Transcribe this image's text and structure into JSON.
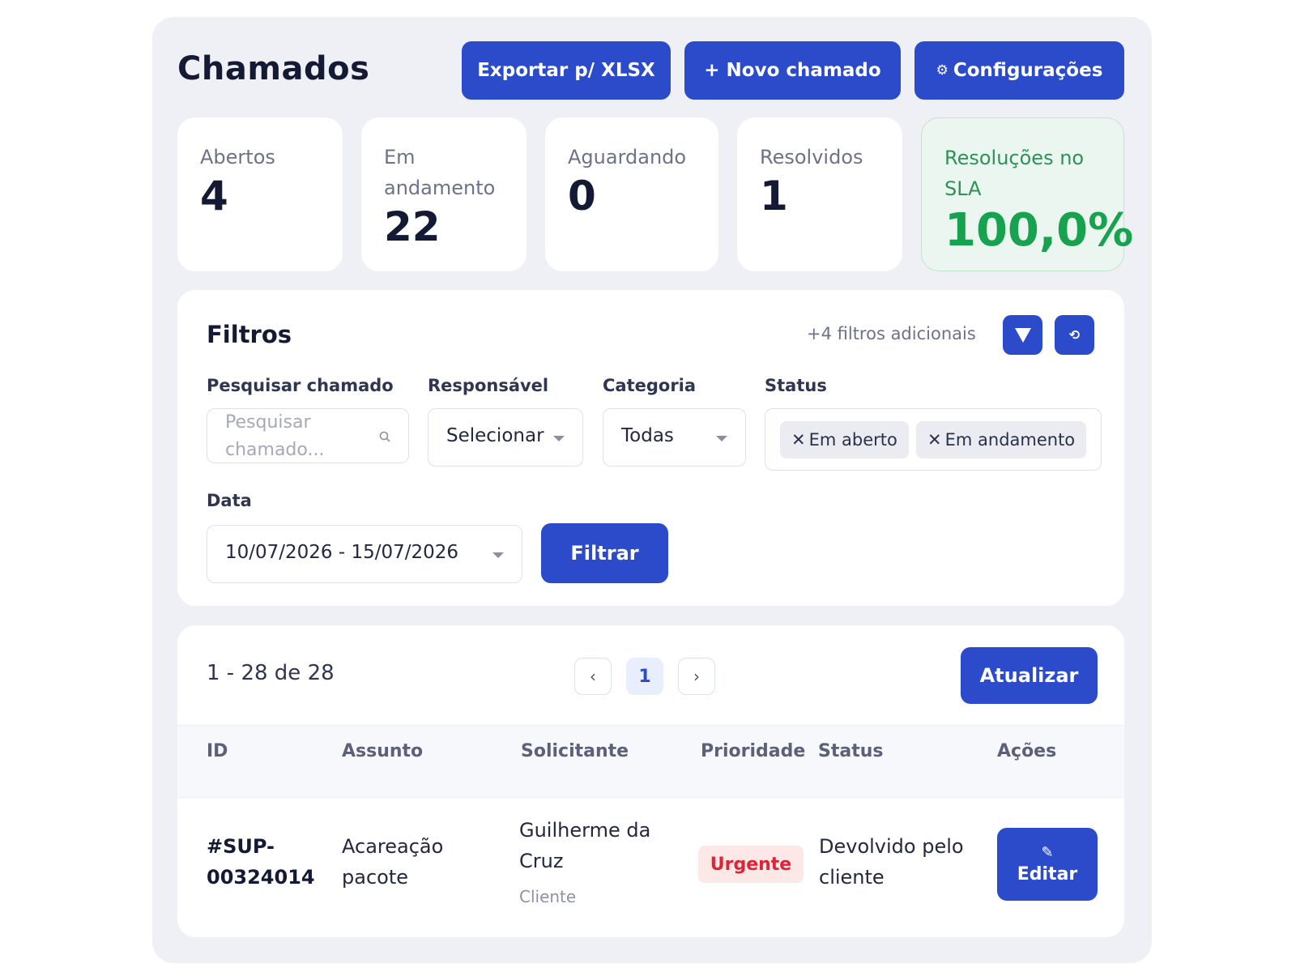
{
  "header": {
    "title": "Chamados",
    "export_label": "Exportar p/ XLSX",
    "new_ticket_label": "+ Novo chamado",
    "settings_label": "Configurações"
  },
  "stats": {
    "open_label": "Abertos",
    "open_value": "4",
    "in_progress_label": "Em andamento",
    "in_progress_value": "22",
    "waiting_label": "Aguardando",
    "waiting_value": "0",
    "resolved_label": "Resolvidos",
    "resolved_value": "1",
    "sla_label": "Resoluções no SLA",
    "sla_value": "100,0%"
  },
  "filters": {
    "title": "Filtros",
    "additional_label": "+4 filtros adicionais",
    "search_label": "Pesquisar chamado",
    "search_placeholder": "Pesquisar chamado...",
    "assignee_label": "Responsável",
    "assignee_value": "Selecionar",
    "category_label": "Categoria",
    "category_value": "Todas",
    "status_label": "Status",
    "status_chips": [
      "Em aberto",
      "Em andamento"
    ],
    "date_label": "Data",
    "date_value": "10/07/2026 - 15/07/2026",
    "filter_button": "Filtrar"
  },
  "results": {
    "range_text": "1 - 28 de 28",
    "prev": "‹",
    "current_page": "1",
    "next": "›",
    "refresh_label": "Atualizar",
    "columns": [
      "ID",
      "Assunto",
      "Solicitante",
      "Prioridade",
      "Status",
      "Ações"
    ],
    "rows": [
      {
        "id": "#SUP-00324014",
        "subject": "Acareação pacote",
        "requester": "Guilherme da Cruz",
        "requester_role": "Cliente",
        "priority": "Urgente",
        "status": "Devolvido pelo cliente",
        "action_label": "Editar"
      }
    ]
  },
  "colors": {
    "primary": "#2c4bcb",
    "panel_bg": "#eef0f5",
    "sla_green": "#17a24f",
    "urgent_red": "#e02435",
    "urgent_bg": "#fde8e8"
  },
  "icons": [
    "gear-icon",
    "filter-icon",
    "reset-icon",
    "search-icon",
    "close-icon",
    "chevron-down-icon",
    "chevron-left-icon",
    "chevron-right-icon",
    "pencil-icon"
  ]
}
